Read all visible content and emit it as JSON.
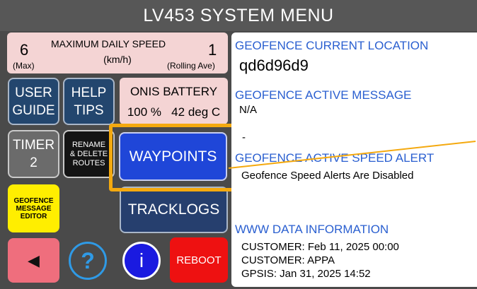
{
  "title": "LV453 SYSTEM MENU",
  "speed": {
    "header": "MAXIMUM DAILY SPEED",
    "unit": "(km/h)",
    "max_value": "6",
    "max_label": "(Max)",
    "rolling_value": "1",
    "rolling_label": "(Rolling Ave)"
  },
  "buttons": {
    "user_guide": [
      "USER",
      "GUIDE"
    ],
    "help_tips": [
      "HELP",
      "TIPS"
    ],
    "timer": [
      "TIMER",
      "2"
    ],
    "rename_delete_routes": [
      "RENAME",
      "& DELETE",
      "ROUTES"
    ],
    "geofence_message_editor": [
      "GEOFENCE",
      "MESSAGE",
      "EDITOR"
    ],
    "waypoints": "WAYPOINTS",
    "tracklogs": "TRACKLOGS",
    "reboot": "REBOOT",
    "back_glyph": "◀",
    "help_glyph": "?",
    "info_glyph": "i"
  },
  "battery": {
    "title": "ONIS BATTERY",
    "value": "100 %   42 deg C"
  },
  "info_panel": {
    "location_header": "GEOFENCE CURRENT LOCATION",
    "location_value": "qd6d96d9",
    "message_header": "GEOFENCE ACTIVE MESSAGE",
    "message_value": "N/A",
    "message_dash": "-",
    "alert_header": "GEOFENCE ACTIVE SPEED ALERT",
    "alert_value": "Geofence Speed Alerts Are Disabled",
    "www_header": "WWW DATA INFORMATION",
    "www_lines": [
      "CUSTOMER: Feb 11, 2025 00:00",
      "CUSTOMER: APPA",
      "GPSIS: Jan 31, 2025 14:52"
    ]
  },
  "colors": {
    "highlight": "#f4a90f",
    "header_blue": "#2a5fd0",
    "panel_pink": "#f4d4d4"
  }
}
